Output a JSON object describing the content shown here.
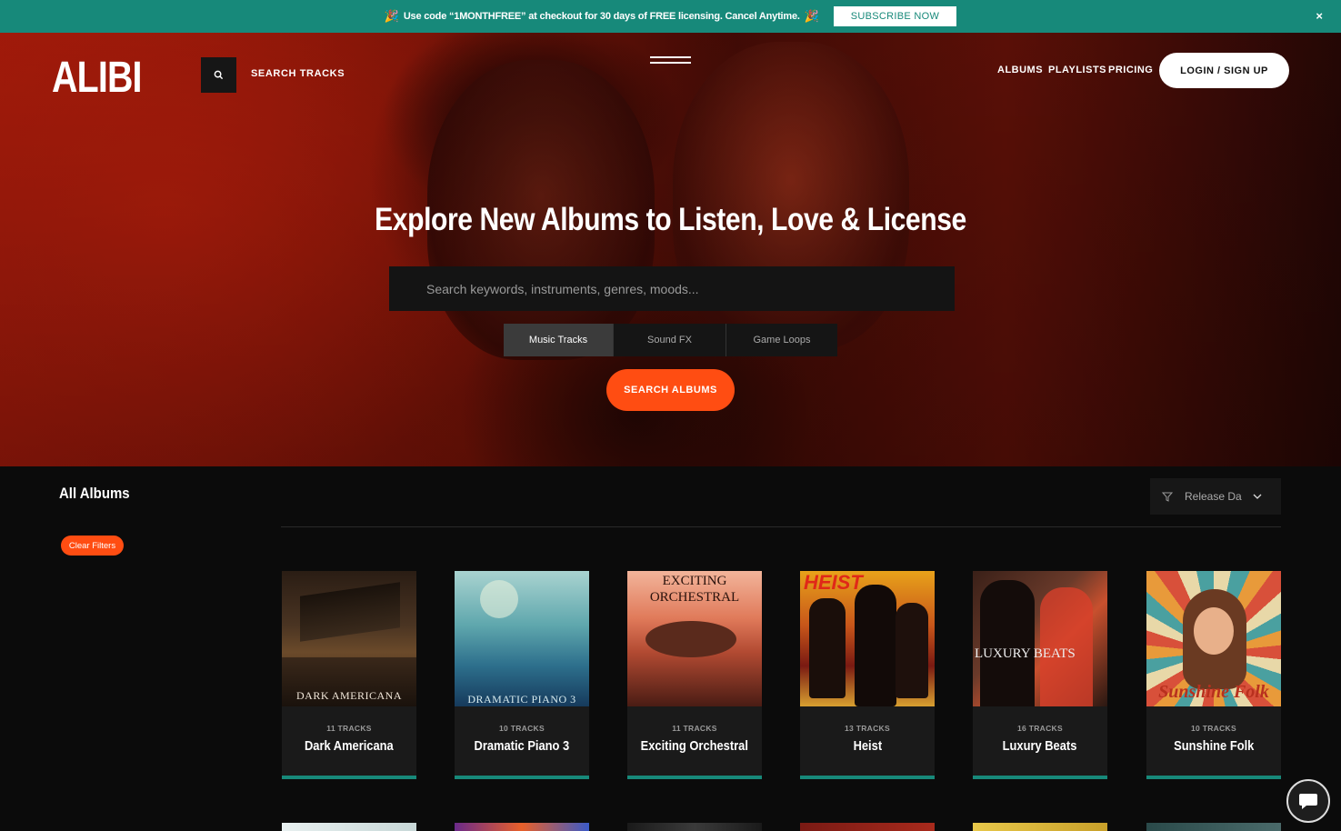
{
  "promo": {
    "emoji": "🎉",
    "text": "Use code “1MONTHFREE” at checkout for 30 days of FREE licensing. Cancel Anytime.",
    "button": "SUBSCRIBE NOW",
    "close": "×"
  },
  "header": {
    "logo": "ALIBI",
    "search_label": "SEARCH TRACKS",
    "nav": [
      "ALBUMS",
      "PLAYLISTS",
      "PRICING"
    ],
    "login": "LOGIN / SIGN UP"
  },
  "hero": {
    "title": "Explore New Albums to Listen, Love & License",
    "search_placeholder": "Search keywords, instruments, genres, moods...",
    "types": [
      "Music Tracks",
      "Sound FX",
      "Game Loops"
    ],
    "active_type": "Music Tracks",
    "search_button": "SEARCH ALBUMS"
  },
  "main": {
    "heading": "All Albums",
    "clear_filters": "Clear Filters",
    "sort_label": "Release Da",
    "albums": [
      {
        "tracks": "11 TRACKS",
        "name": "Dark Americana",
        "cover_text": "DARK AMERICANA"
      },
      {
        "tracks": "10 TRACKS",
        "name": "Dramatic Piano 3",
        "cover_text": "DRAMATIC PIANO 3"
      },
      {
        "tracks": "11 TRACKS",
        "name": "Exciting Orchestral",
        "cover_text": "EXCITING ORCHESTRAL"
      },
      {
        "tracks": "13 TRACKS",
        "name": "Heist",
        "cover_text": "HEIST"
      },
      {
        "tracks": "16 TRACKS",
        "name": "Luxury Beats",
        "cover_text": "LUXURY BEATS"
      },
      {
        "tracks": "10 TRACKS",
        "name": "Sunshine Folk",
        "cover_text": "Sunshine Folk"
      }
    ]
  },
  "colors": {
    "accent": "#17897a",
    "orange": "#ff4d12"
  }
}
